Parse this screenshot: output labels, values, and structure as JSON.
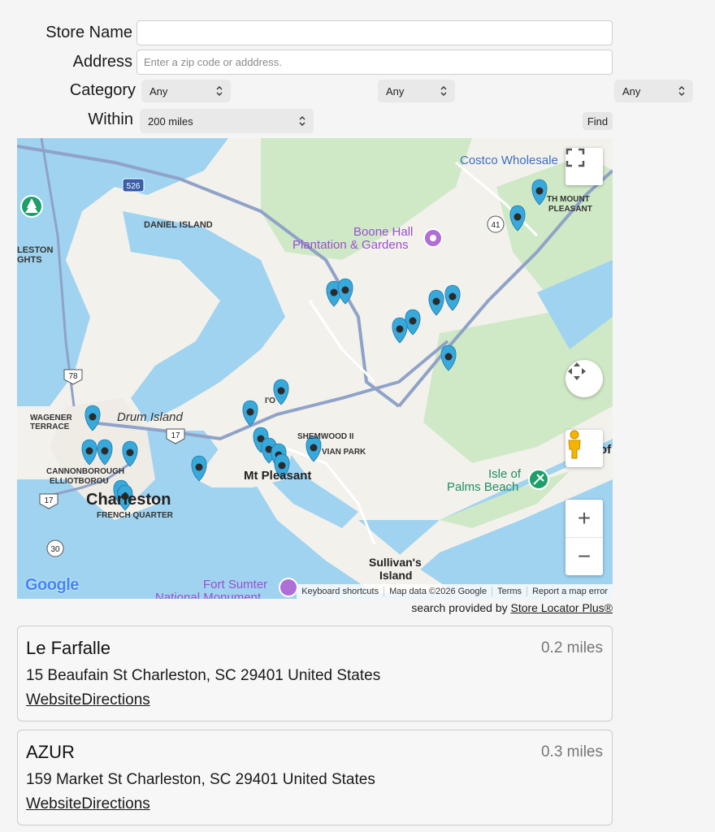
{
  "form": {
    "store_name_label": "Store Name",
    "store_name_value": "",
    "address_label": "Address",
    "address_placeholder": "Enter a zip code or adddress.",
    "category_label": "Category",
    "category_selects": [
      "Any",
      "Any",
      "Any"
    ],
    "within_label": "Within",
    "within_value": "200 miles",
    "find_label": "Find"
  },
  "map": {
    "labels": {
      "costco": "Costco Wholesale",
      "mount_pleasant_n": "TH MOUNT",
      "pleasant": "PLEASANT",
      "daniel_island": "DANIEL ISLAND",
      "boone_hall_1": "Boone Hall",
      "boone_hall_2": "Plantation & Gardens",
      "leston": "LESTON",
      "ghts": "GHTS",
      "wagener_1": "WAGENER",
      "wagener_2": "TERRACE",
      "drum_island": "Drum Island",
      "io": "I'O",
      "shemwood": "SHEMWOOD II",
      "vian_park": "VIAN PARK",
      "mt_pleasant": "Mt Pleasant",
      "cannonborough": "CANNONBOROUGH",
      "elliotborough": "ELLIOTBOROU",
      "charleston": "Charleston",
      "french_quarter": "FRENCH QUARTER",
      "isle_of": "Isle of",
      "palms_beach": "Palms Beach",
      "sullivans_1": "Sullivan's",
      "sullivans_2": "Island",
      "fort_sumter_1": "Fort Sumter",
      "fort_sumter_2": "National Monument",
      "of_edge": "of"
    },
    "route_shields": [
      "526",
      "41",
      "78",
      "17",
      "17",
      "30"
    ],
    "attribution": {
      "shortcuts": "Keyboard shortcuts",
      "map_data": "Map data ©2026 Google",
      "terms": "Terms",
      "report": "Report a map error"
    },
    "logo": "Google",
    "zoom_in": "+",
    "zoom_out": "−"
  },
  "provider": {
    "prefix": "search provided by ",
    "link": "Store Locator Plus®"
  },
  "results": [
    {
      "name": "Le Farfalle",
      "distance": "0.2 miles",
      "address": "15 Beaufain St Charleston, SC 29401 United States",
      "website": "Website",
      "directions": "Directions"
    },
    {
      "name": "AZUR",
      "distance": "0.3 miles",
      "address": "159 Market St Charleston, SC 29401 United States",
      "website": "Website",
      "directions": "Directions"
    }
  ],
  "colors": {
    "water": "#9fd3f0",
    "land": "#f3f1ec",
    "park": "#c9e8c4",
    "marker": "#39a9dc",
    "marker_dot": "#2b2b2b"
  }
}
